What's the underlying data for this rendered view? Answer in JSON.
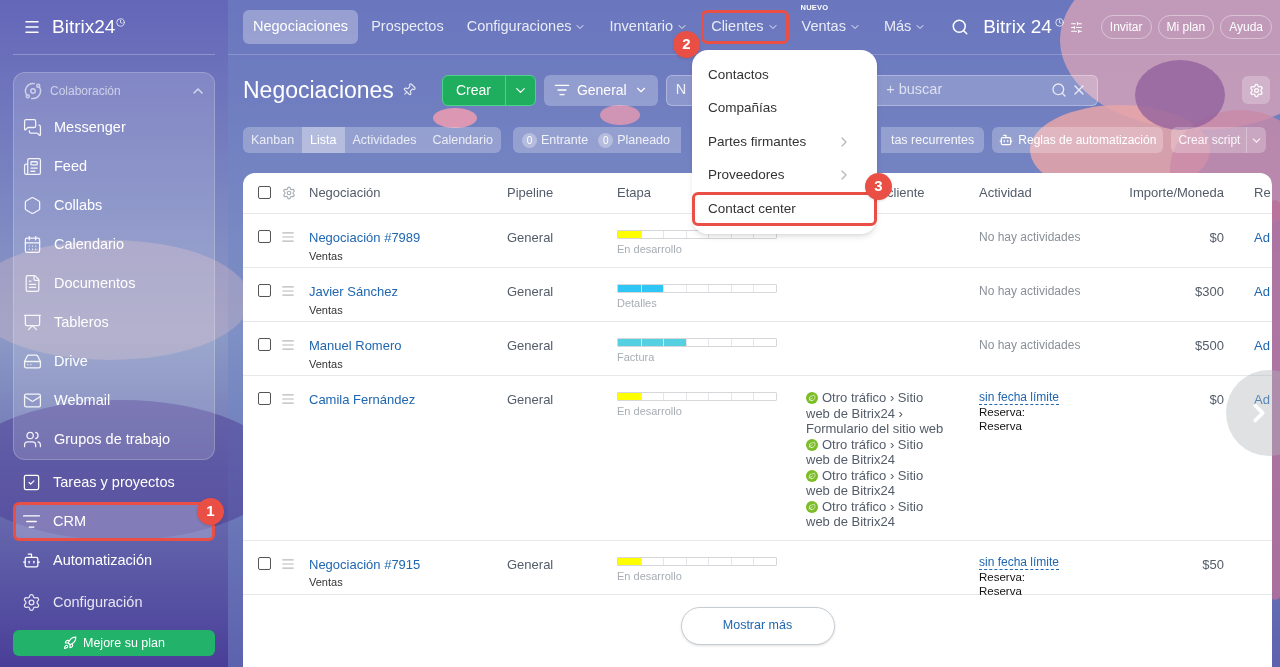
{
  "sidebar": {
    "logo": "Bitrix24",
    "group": {
      "title": "Colaboración",
      "expanded": true,
      "items": [
        {
          "label": "Messenger"
        },
        {
          "label": "Feed"
        },
        {
          "label": "Collabs"
        },
        {
          "label": "Calendario"
        },
        {
          "label": "Documentos"
        },
        {
          "label": "Tableros"
        },
        {
          "label": "Drive"
        },
        {
          "label": "Webmail"
        },
        {
          "label": "Grupos de trabajo"
        }
      ]
    },
    "items": [
      {
        "label": "Tareas y proyectos",
        "selected": false,
        "highlighted": false
      },
      {
        "label": "CRM",
        "selected": true,
        "highlighted": true
      },
      {
        "label": "Automatización",
        "selected": false,
        "highlighted": false
      },
      {
        "label": "Configuración",
        "selected": false,
        "highlighted": false
      }
    ],
    "upgrade_button": "Mejore su plan"
  },
  "top_nav": {
    "tabs": [
      {
        "label": "Negociaciones",
        "selected": true,
        "dropdown": false,
        "highlighted": false
      },
      {
        "label": "Prospectos",
        "selected": false,
        "dropdown": false,
        "highlighted": false
      },
      {
        "label": "Configuraciones",
        "selected": false,
        "dropdown": true,
        "highlighted": false
      },
      {
        "label": "Inventario",
        "selected": false,
        "dropdown": true,
        "highlighted": false
      },
      {
        "label": "Clientes",
        "selected": false,
        "dropdown": true,
        "highlighted": true
      },
      {
        "label": "Ventas",
        "badge": "NUEVO",
        "selected": false,
        "dropdown": true,
        "highlighted": false
      },
      {
        "label": "Más",
        "selected": false,
        "dropdown": true,
        "highlighted": false
      }
    ],
    "logo": "Bitrix 24",
    "buttons": [
      "Invitar",
      "Mi plan",
      "Ayuda"
    ]
  },
  "dropdown_menu": {
    "items": [
      {
        "label": "Contactos",
        "submenu": false,
        "highlighted": false
      },
      {
        "label": "Compañías",
        "submenu": false,
        "highlighted": false
      },
      {
        "label": "Partes firmantes",
        "submenu": true,
        "highlighted": false
      },
      {
        "label": "Proveedores",
        "submenu": true,
        "highlighted": false
      },
      {
        "label": "Contact center",
        "submenu": false,
        "highlighted": true
      }
    ]
  },
  "toolbar": {
    "title": "Negociaciones",
    "create_button": "Crear",
    "filter_button": "General",
    "search": {
      "filter_tag": "N",
      "placeholder": "+ buscar"
    }
  },
  "views": [
    {
      "label": "Kanban",
      "selected": false
    },
    {
      "label": "Lista",
      "selected": true
    },
    {
      "label": "Actividades",
      "selected": false
    },
    {
      "label": "Calendario",
      "selected": false
    }
  ],
  "counters": [
    {
      "count": "0",
      "label": "Entrante"
    },
    {
      "count": "0",
      "label": "Planeado"
    }
  ],
  "recurring_chip": "tas recurrentes",
  "automation_button": "Reglas de automatización",
  "script_button": "Crear script",
  "table": {
    "header_checked": false,
    "columns": [
      "Negociación",
      "Pipeline",
      "Etapa",
      "cliente",
      "Actividad",
      "Importe/Moneda",
      "Re"
    ],
    "rows": [
      {
        "checked": false,
        "title": "Negociación #7989",
        "subtitle": "Ventas",
        "pipeline": "General",
        "stage": {
          "label": "En desarrollo",
          "level": 0.143,
          "color": "#ffff00"
        },
        "sources": [],
        "activity": {
          "kind": "none",
          "text": "No hay actividades"
        },
        "amount": "$0",
        "responsible": "Ad"
      },
      {
        "checked": false,
        "title": "Javier Sánchez",
        "subtitle": "Ventas",
        "pipeline": "General",
        "stage": {
          "label": "Detalles",
          "level": 0.286,
          "color": "#2fc6f6"
        },
        "sources": [],
        "activity": {
          "kind": "none",
          "text": "No hay actividades"
        },
        "amount": "$300",
        "responsible": "Ad"
      },
      {
        "checked": false,
        "title": "Manuel Romero",
        "subtitle": "Ventas",
        "pipeline": "General",
        "stage": {
          "label": "Factura",
          "level": 0.429,
          "color": "#55d0e0"
        },
        "sources": [],
        "activity": {
          "kind": "none",
          "text": "No hay actividades"
        },
        "amount": "$500",
        "responsible": "Ad"
      },
      {
        "checked": false,
        "title": "Camila Fernández",
        "pipeline": "General",
        "stage": {
          "label": "En desarrollo",
          "level": 0.143,
          "color": "#ffff00"
        },
        "sources": [
          "Otro tráfico › Sitio web de Bitrix24 › Formulario del sitio web",
          "Otro tráfico › Sitio web de Bitrix24",
          "Otro tráfico › Sitio web de Bitrix24",
          "Otro tráfico › Sitio web de Bitrix24"
        ],
        "activity": {
          "kind": "deadline",
          "text": "sin fecha límite",
          "lines": [
            "Reserva:",
            "Reserva"
          ]
        },
        "amount": "$0",
        "responsible": "Ad"
      },
      {
        "checked": false,
        "title": "Negociación #7915",
        "subtitle": "Ventas",
        "pipeline": "General",
        "stage": {
          "label": "En desarrollo",
          "level": 0.143,
          "color": "#ffff00"
        },
        "sources": [],
        "activity": {
          "kind": "deadline",
          "text": "sin fecha límite",
          "lines": [
            "Reserva:",
            "Reserva"
          ]
        },
        "amount": "$50"
      }
    ]
  },
  "show_more": "Mostrar más",
  "annotations": [
    "1",
    "2",
    "3"
  ]
}
